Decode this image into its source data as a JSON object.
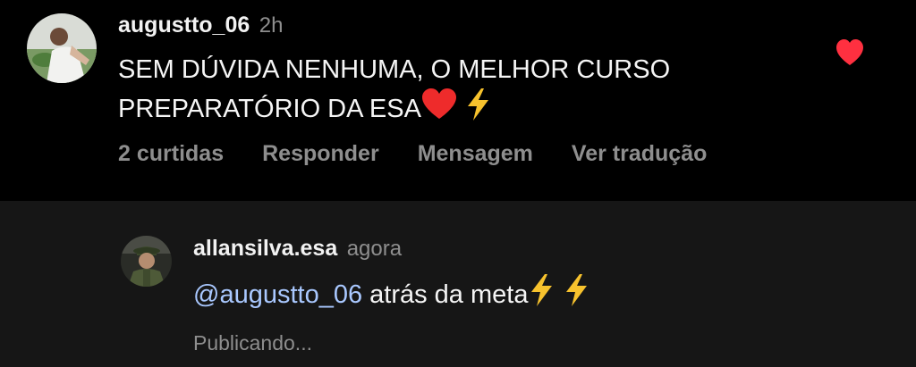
{
  "comment": {
    "username": "augustto_06",
    "time": "2h",
    "text_line1": "SEM DÚVIDA NENHUMA, O MELHOR CURSO",
    "text_line2": "PREPARATÓRIO DA ESA",
    "likes": "2 curtidas",
    "reply_label": "Responder",
    "message_label": "Mensagem",
    "translate_label": "Ver tradução",
    "liked": true,
    "heart_color": "#ff3040"
  },
  "reply": {
    "username": "allansilva.esa",
    "time": "agora",
    "mention": "@augustto_06",
    "text": " atrás da meta",
    "status": "Publicando..."
  },
  "colors": {
    "mention": "#a9c8ff",
    "muted": "#8e8e8e",
    "reply_bg": "#161616"
  },
  "icons": {
    "comment_avatar": "user-avatar",
    "reply_avatar": "user-avatar",
    "heart": "heart-icon",
    "emoji_heart": "red-heart-emoji",
    "emoji_bolt": "lightning-emoji"
  }
}
